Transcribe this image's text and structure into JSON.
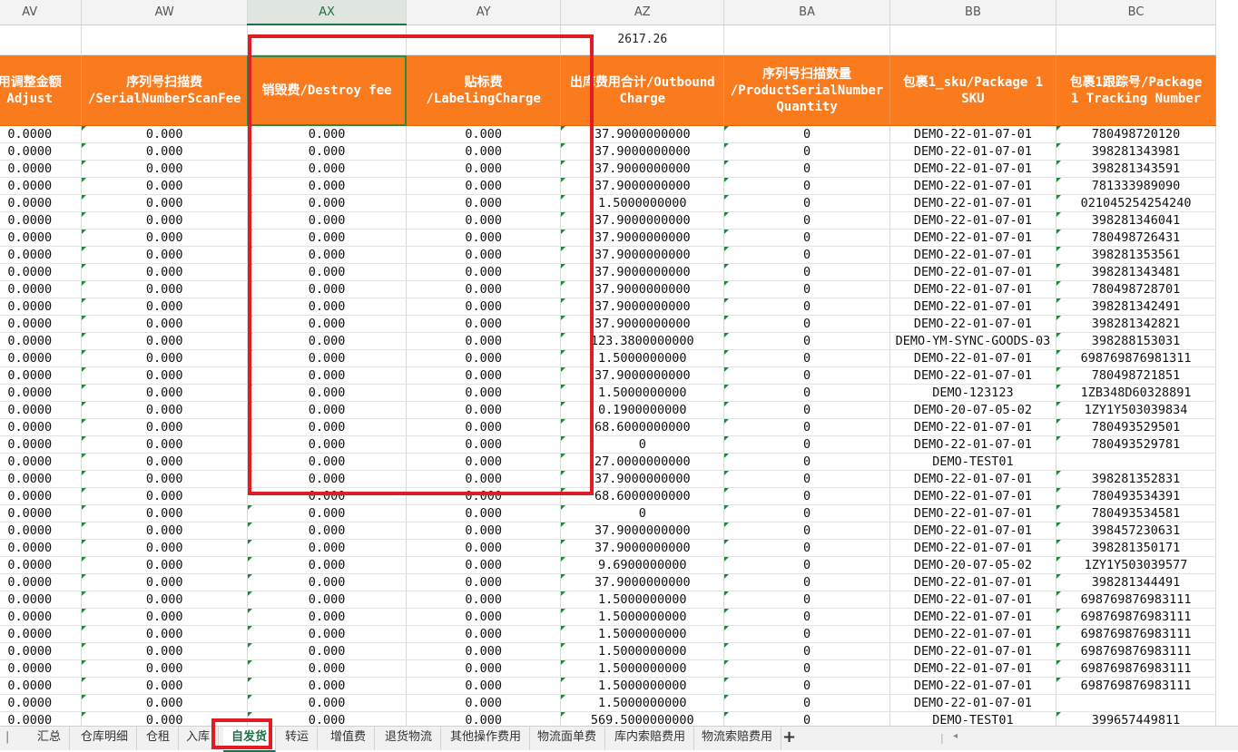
{
  "columns": [
    "AV",
    "AW",
    "AX",
    "AY",
    "AZ",
    "BA",
    "BB",
    "BC"
  ],
  "selected_column": "AX",
  "totals": [
    "",
    "",
    "",
    "",
    "2617.26",
    "",
    "",
    ""
  ],
  "headers": [
    [
      "用调整金额",
      "Adjust"
    ],
    [
      "序列号扫描费",
      "/SerialNumberScanFee"
    ],
    [
      "销毁费/Destroy fee"
    ],
    [
      "贴标费",
      "/LabelingCharge"
    ],
    [
      "出库费用合计/Outbound",
      "Charge"
    ],
    [
      "序列号扫描数量",
      "/ProductSerialNumber",
      "Quantity"
    ],
    [
      "包裹1_sku/Package 1",
      "SKU"
    ],
    [
      "包裹1跟踪号/Package",
      "1 Tracking Number"
    ]
  ],
  "rows": [
    [
      "0.0000",
      "0.000",
      "0.000",
      "0.000",
      "37.9000000000",
      "0",
      "DEMO-22-01-07-01",
      "780498720120"
    ],
    [
      "0.0000",
      "0.000",
      "0.000",
      "0.000",
      "37.9000000000",
      "0",
      "DEMO-22-01-07-01",
      "398281343981"
    ],
    [
      "0.0000",
      "0.000",
      "0.000",
      "0.000",
      "37.9000000000",
      "0",
      "DEMO-22-01-07-01",
      "398281343591"
    ],
    [
      "0.0000",
      "0.000",
      "0.000",
      "0.000",
      "37.9000000000",
      "0",
      "DEMO-22-01-07-01",
      "781333989090"
    ],
    [
      "0.0000",
      "0.000",
      "0.000",
      "0.000",
      "1.5000000000",
      "0",
      "DEMO-22-01-07-01",
      "021045254254240"
    ],
    [
      "0.0000",
      "0.000",
      "0.000",
      "0.000",
      "37.9000000000",
      "0",
      "DEMO-22-01-07-01",
      "398281346041"
    ],
    [
      "0.0000",
      "0.000",
      "0.000",
      "0.000",
      "37.9000000000",
      "0",
      "DEMO-22-01-07-01",
      "780498726431"
    ],
    [
      "0.0000",
      "0.000",
      "0.000",
      "0.000",
      "37.9000000000",
      "0",
      "DEMO-22-01-07-01",
      "398281353561"
    ],
    [
      "0.0000",
      "0.000",
      "0.000",
      "0.000",
      "37.9000000000",
      "0",
      "DEMO-22-01-07-01",
      "398281343481"
    ],
    [
      "0.0000",
      "0.000",
      "0.000",
      "0.000",
      "37.9000000000",
      "0",
      "DEMO-22-01-07-01",
      "780498728701"
    ],
    [
      "0.0000",
      "0.000",
      "0.000",
      "0.000",
      "37.9000000000",
      "0",
      "DEMO-22-01-07-01",
      "398281342491"
    ],
    [
      "0.0000",
      "0.000",
      "0.000",
      "0.000",
      "37.9000000000",
      "0",
      "DEMO-22-01-07-01",
      "398281342821"
    ],
    [
      "0.0000",
      "0.000",
      "0.000",
      "0.000",
      "123.3800000000",
      "0",
      "DEMO-YM-SYNC-GOODS-03",
      "398288153031"
    ],
    [
      "0.0000",
      "0.000",
      "0.000",
      "0.000",
      "1.5000000000",
      "0",
      "DEMO-22-01-07-01",
      "698769876981311"
    ],
    [
      "0.0000",
      "0.000",
      "0.000",
      "0.000",
      "37.9000000000",
      "0",
      "DEMO-22-01-07-01",
      "780498721851"
    ],
    [
      "0.0000",
      "0.000",
      "0.000",
      "0.000",
      "1.5000000000",
      "0",
      "DEMO-123123",
      "1ZB348D60328891"
    ],
    [
      "0.0000",
      "0.000",
      "0.000",
      "0.000",
      "0.1900000000",
      "0",
      "DEMO-20-07-05-02",
      "1ZY1Y503039834"
    ],
    [
      "0.0000",
      "0.000",
      "0.000",
      "0.000",
      "68.6000000000",
      "0",
      "DEMO-22-01-07-01",
      "780493529501"
    ],
    [
      "0.0000",
      "0.000",
      "0.000",
      "0.000",
      "0",
      "0",
      "DEMO-22-01-07-01",
      "780493529781"
    ],
    [
      "0.0000",
      "0.000",
      "0.000",
      "0.000",
      "27.0000000000",
      "0",
      "DEMO-TEST01",
      ""
    ],
    [
      "0.0000",
      "0.000",
      "0.000",
      "0.000",
      "37.9000000000",
      "0",
      "DEMO-22-01-07-01",
      "398281352831"
    ],
    [
      "0.0000",
      "0.000",
      "0.000",
      "0.000",
      "68.6000000000",
      "0",
      "DEMO-22-01-07-01",
      "780493534391"
    ],
    [
      "0.0000",
      "0.000",
      "0.000",
      "0.000",
      "0",
      "0",
      "DEMO-22-01-07-01",
      "780493534581"
    ],
    [
      "0.0000",
      "0.000",
      "0.000",
      "0.000",
      "37.9000000000",
      "0",
      "DEMO-22-01-07-01",
      "398457230631"
    ],
    [
      "0.0000",
      "0.000",
      "0.000",
      "0.000",
      "37.9000000000",
      "0",
      "DEMO-22-01-07-01",
      "398281350171"
    ],
    [
      "0.0000",
      "0.000",
      "0.000",
      "0.000",
      "9.6900000000",
      "0",
      "DEMO-20-07-05-02",
      "1ZY1Y503039577"
    ],
    [
      "0.0000",
      "0.000",
      "0.000",
      "0.000",
      "37.9000000000",
      "0",
      "DEMO-22-01-07-01",
      "398281344491"
    ],
    [
      "0.0000",
      "0.000",
      "0.000",
      "0.000",
      "1.5000000000",
      "0",
      "DEMO-22-01-07-01",
      "698769876983111"
    ],
    [
      "0.0000",
      "0.000",
      "0.000",
      "0.000",
      "1.5000000000",
      "0",
      "DEMO-22-01-07-01",
      "698769876983111"
    ],
    [
      "0.0000",
      "0.000",
      "0.000",
      "0.000",
      "1.5000000000",
      "0",
      "DEMO-22-01-07-01",
      "698769876983111"
    ],
    [
      "0.0000",
      "0.000",
      "0.000",
      "0.000",
      "1.5000000000",
      "0",
      "DEMO-22-01-07-01",
      "698769876983111"
    ],
    [
      "0.0000",
      "0.000",
      "0.000",
      "0.000",
      "1.5000000000",
      "0",
      "DEMO-22-01-07-01",
      "698769876983111"
    ],
    [
      "0.0000",
      "0.000",
      "0.000",
      "0.000",
      "1.5000000000",
      "0",
      "DEMO-22-01-07-01",
      "698769876983111"
    ],
    [
      "0.0000",
      "0.000",
      "0.000",
      "0.000",
      "1.5000000000",
      "0",
      "DEMO-22-01-07-01",
      ""
    ],
    [
      "0.0000",
      "0.000",
      "0.000",
      "0.000",
      "569.5000000000",
      "0",
      "DEMO-TEST01",
      "399657449811"
    ]
  ],
  "sheet_tabs": [
    "汇总",
    "仓库明细",
    "仓租",
    "入库",
    "自发货",
    "转运",
    "增值费",
    "退货物流",
    "其他操作费用",
    "物流面单费",
    "库内索赔费用",
    "物流索赔费用"
  ],
  "active_tab": "自发货",
  "ui": {
    "add_sheet": "+",
    "nav_first": "|",
    "scroll_left": "◂",
    "divider": "|"
  }
}
